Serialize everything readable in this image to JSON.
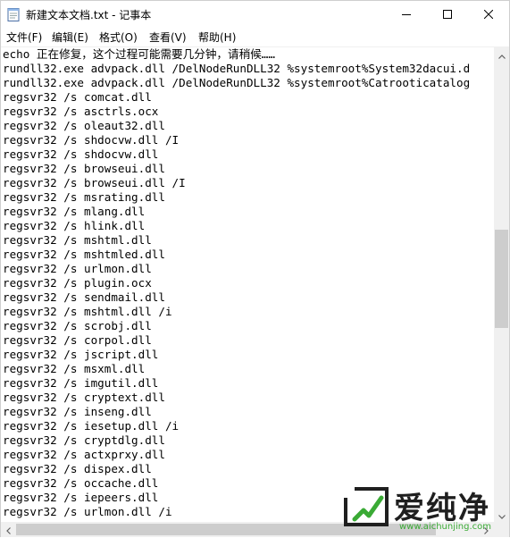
{
  "window": {
    "title": "新建文本文档.txt - 记事本"
  },
  "menu": [
    {
      "label": "文件(F)"
    },
    {
      "label": "编辑(E)"
    },
    {
      "label": "格式(O)"
    },
    {
      "label": "查看(V)"
    },
    {
      "label": "帮助(H)"
    }
  ],
  "editor": {
    "lines": [
      "echo 正在修复，这个过程可能需要几分钟，请稍候……",
      "rundll32.exe advpack.dll /DelNodeRunDLL32 %systemroot%System32dacui.d",
      "rundll32.exe advpack.dll /DelNodeRunDLL32 %systemroot%Catrooticatalog",
      "regsvr32 /s comcat.dll",
      "regsvr32 /s asctrls.ocx",
      "regsvr32 /s oleaut32.dll",
      "regsvr32 /s shdocvw.dll /I",
      "regsvr32 /s shdocvw.dll",
      "regsvr32 /s browseui.dll",
      "regsvr32 /s browseui.dll /I",
      "regsvr32 /s msrating.dll",
      "regsvr32 /s mlang.dll",
      "regsvr32 /s hlink.dll",
      "regsvr32 /s mshtml.dll",
      "regsvr32 /s mshtmled.dll",
      "regsvr32 /s urlmon.dll",
      "regsvr32 /s plugin.ocx",
      "regsvr32 /s sendmail.dll",
      "regsvr32 /s mshtml.dll /i",
      "regsvr32 /s scrobj.dll",
      "regsvr32 /s corpol.dll",
      "regsvr32 /s jscript.dll",
      "regsvr32 /s msxml.dll",
      "regsvr32 /s imgutil.dll",
      "regsvr32 /s cryptext.dll",
      "regsvr32 /s inseng.dll",
      "regsvr32 /s iesetup.dll /i",
      "regsvr32 /s cryptdlg.dll",
      "regsvr32 /s actxprxy.dll",
      "regsvr32 /s dispex.dll",
      "regsvr32 /s occache.dll",
      "regsvr32 /s iepeers.dll",
      "regsvr32 /s urlmon.dll /i"
    ]
  },
  "watermark": {
    "name": "爱纯净",
    "url": "www.aichunjing.com",
    "accent_color": "#3aaa35"
  },
  "icons": {
    "app": "notepad-icon",
    "minimize": "minimize-icon",
    "maximize": "maximize-icon",
    "close": "close-icon"
  }
}
